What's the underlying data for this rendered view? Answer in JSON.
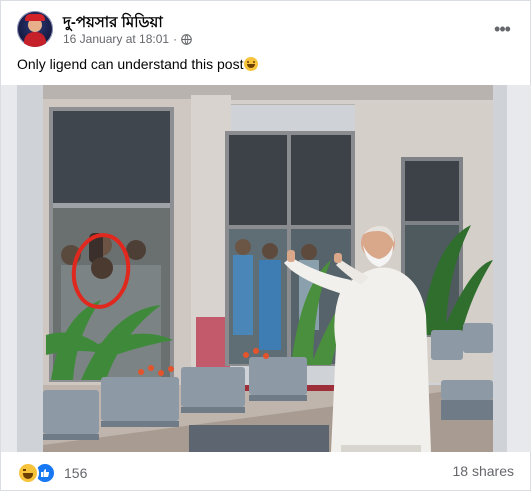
{
  "post": {
    "page_name": "দু-পয়সার মিডিয়া",
    "timestamp": "16 January at 18:01",
    "separator": "·",
    "privacy_icon": "globe-icon",
    "more_icon": "more-options-icon",
    "more_symbol": "•••",
    "caption": "Only ligend can understand this post",
    "caption_emoji": "grinning-face-emoji"
  },
  "photo": {
    "description_icon": "post-photo"
  },
  "footer": {
    "reaction_icons": [
      "haha-reaction-icon",
      "like-reaction-icon"
    ],
    "reaction_count": "156",
    "shares": "18 shares"
  },
  "colors": {
    "text_primary": "#050505",
    "text_secondary": "#65676b",
    "like_blue": "#1877f2",
    "haha_yellow": "#f7c33b",
    "highlight_circle": "#e0281e"
  }
}
